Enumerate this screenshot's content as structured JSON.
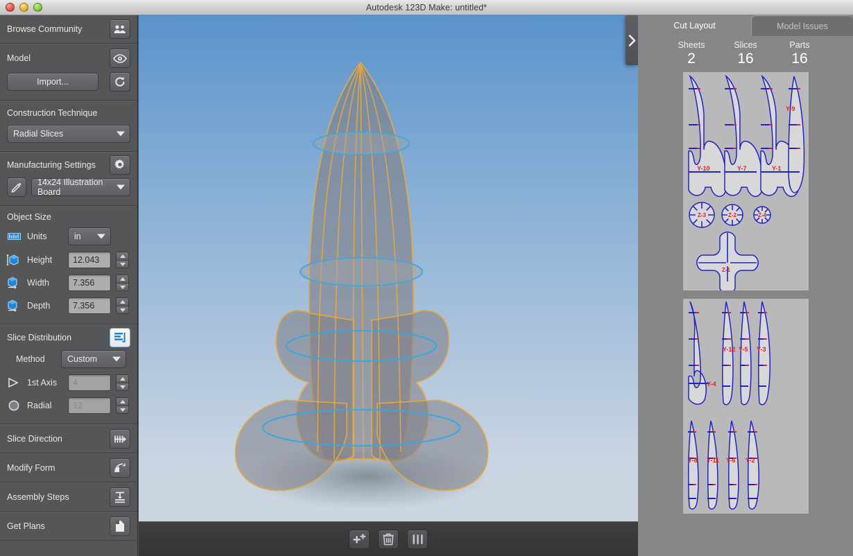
{
  "window": {
    "title": "Autodesk 123D Make: untitled*",
    "controls": [
      "close",
      "minimize",
      "maximize"
    ]
  },
  "sidebar": {
    "sections": [
      {
        "id": "browse-community",
        "label": "Browse Community",
        "icon": "community-icon"
      },
      {
        "id": "model",
        "label": "Model",
        "icon": "eye-icon",
        "import_label": "Import...",
        "refresh_icon": "refresh-icon"
      },
      {
        "id": "construction-technique",
        "label": "Construction Technique",
        "technique_value": "Radial Slices"
      },
      {
        "id": "manufacturing-settings",
        "label": "Manufacturing Settings",
        "icon": "gear-icon",
        "edit_icon": "pencil-icon",
        "material_value": "14x24 Illustration Board"
      },
      {
        "id": "object-size",
        "label": "Object Size"
      },
      {
        "id": "slice-distribution",
        "label": "Slice Distribution",
        "icon": "distribution-icon"
      },
      {
        "id": "slice-direction",
        "label": "Slice Direction",
        "icon": "slice-direction-icon"
      },
      {
        "id": "modify-form",
        "label": "Modify Form",
        "icon": "modify-form-icon"
      },
      {
        "id": "assembly-steps",
        "label": "Assembly Steps",
        "icon": "assembly-steps-icon"
      },
      {
        "id": "get-plans",
        "label": "Get Plans",
        "icon": "plans-icon"
      }
    ],
    "object_size": {
      "units_label": "Units",
      "units_value": "in",
      "fields": [
        {
          "label": "Height",
          "value": "12.043",
          "icon": "cube-height-icon"
        },
        {
          "label": "Width",
          "value": "7.356",
          "icon": "cube-width-icon"
        },
        {
          "label": "Depth",
          "value": "7.356",
          "icon": "cube-depth-icon"
        }
      ]
    },
    "slice_distribution": {
      "method_label": "Method",
      "method_value": "Custom",
      "axis_label": "1st Axis",
      "axis_value": "4",
      "radial_label": "Radial",
      "radial_value": "12"
    }
  },
  "viewport": {
    "collapse_icon": "chevron-right-icon",
    "model_name": "rocket",
    "toolbar": [
      {
        "id": "add-slice",
        "icon": "add-plus-icon"
      },
      {
        "id": "delete-slice",
        "icon": "trash-icon"
      },
      {
        "id": "slice-columns",
        "icon": "columns-icon"
      }
    ]
  },
  "right_panel": {
    "tabs": [
      {
        "id": "cut-layout",
        "label": "Cut Layout",
        "active": true
      },
      {
        "id": "model-issues",
        "label": "Model Issues",
        "active": false
      }
    ],
    "stats": [
      {
        "key": "Sheets",
        "value": "2"
      },
      {
        "key": "Slices",
        "value": "16"
      },
      {
        "key": "Parts",
        "value": "16"
      }
    ],
    "sheets": [
      {
        "id": "sheet-1",
        "fin_parts": [
          "Y-10",
          "Y-7",
          "Y-1",
          "Y-9"
        ],
        "disc_parts": [
          "Z-3",
          "Z-2",
          "Z-4"
        ],
        "cross_part": "Z-1"
      },
      {
        "id": "sheet-2",
        "row1_parts": [
          "Y-4",
          "Y-12",
          "Y-5",
          "Y-3"
        ],
        "row2_parts": [
          "Y-8",
          "Y-11",
          "Y-6",
          "Y-2"
        ]
      }
    ],
    "part_label_color": "#e02020",
    "part_outline_color": "#2222cc",
    "part_fill_color": "#d8d8d8"
  }
}
